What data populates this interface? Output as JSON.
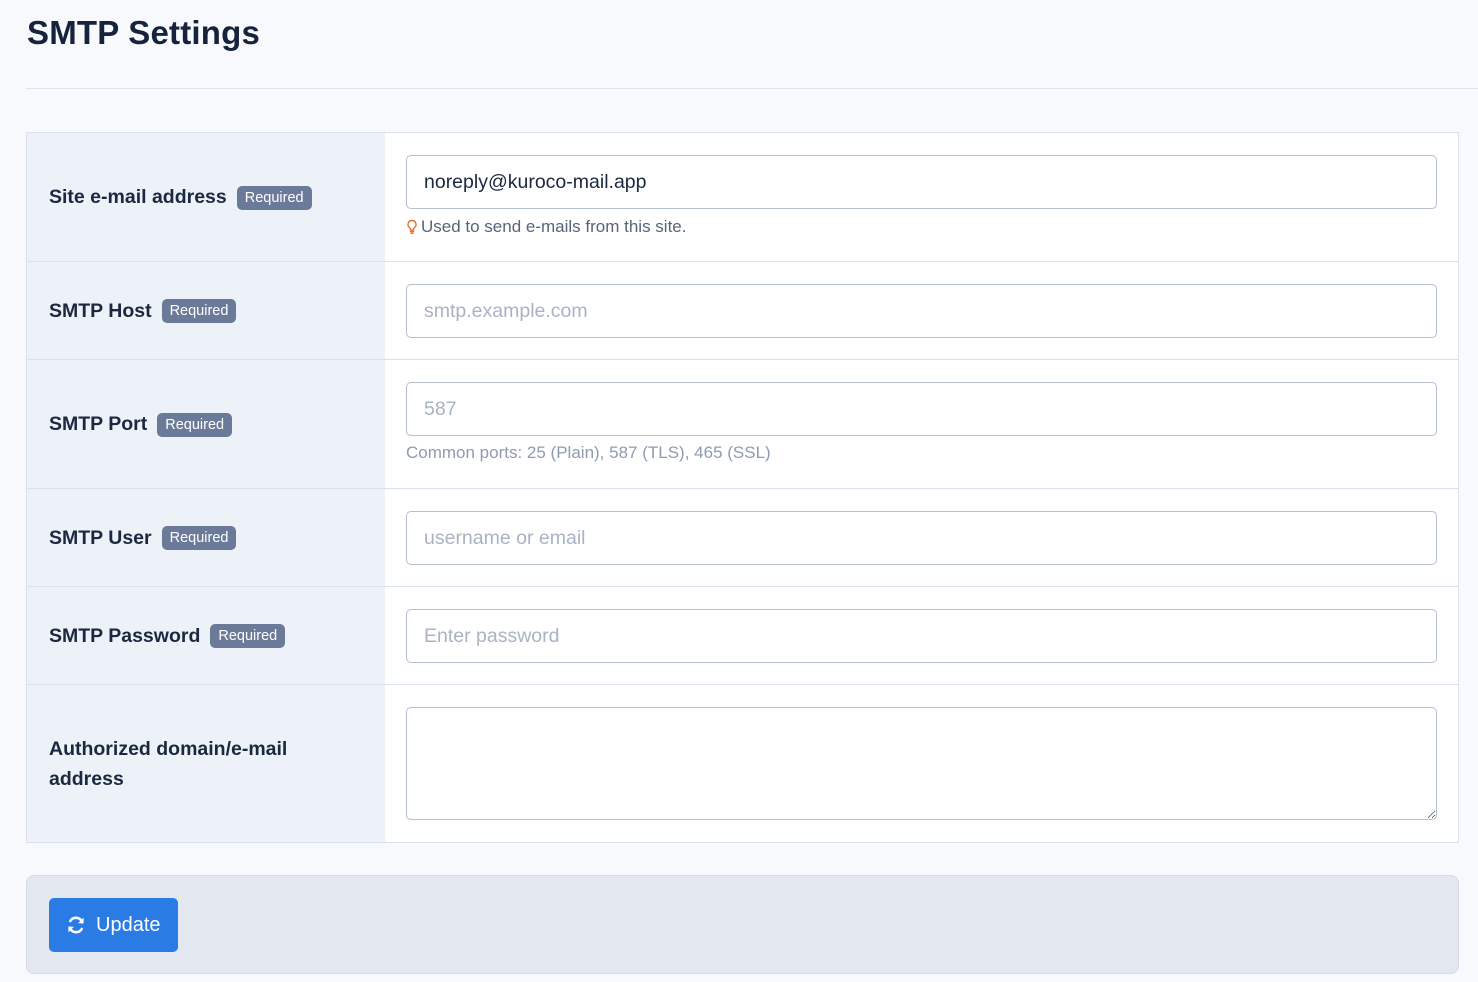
{
  "page": {
    "title": "SMTP Settings"
  },
  "required_label": "Required",
  "fields": {
    "site_email": {
      "label": "Site e-mail address",
      "value": "noreply@kuroco-mail.app",
      "help": "Used to send e-mails from this site."
    },
    "smtp_host": {
      "label": "SMTP Host",
      "placeholder": "smtp.example.com"
    },
    "smtp_port": {
      "label": "SMTP Port",
      "placeholder": "587",
      "help": "Common ports: 25 (Plain), 587 (TLS), 465 (SSL)"
    },
    "smtp_user": {
      "label": "SMTP User",
      "placeholder": "username or email"
    },
    "smtp_password": {
      "label": "SMTP Password",
      "placeholder": "Enter password"
    },
    "authorized": {
      "label": "Authorized domain/e-mail address",
      "value": ""
    }
  },
  "actions": {
    "update_label": "Update"
  },
  "colors": {
    "accent": "#2a7be4",
    "badge": "#6b7a99",
    "hint_icon": "#e8742a"
  }
}
